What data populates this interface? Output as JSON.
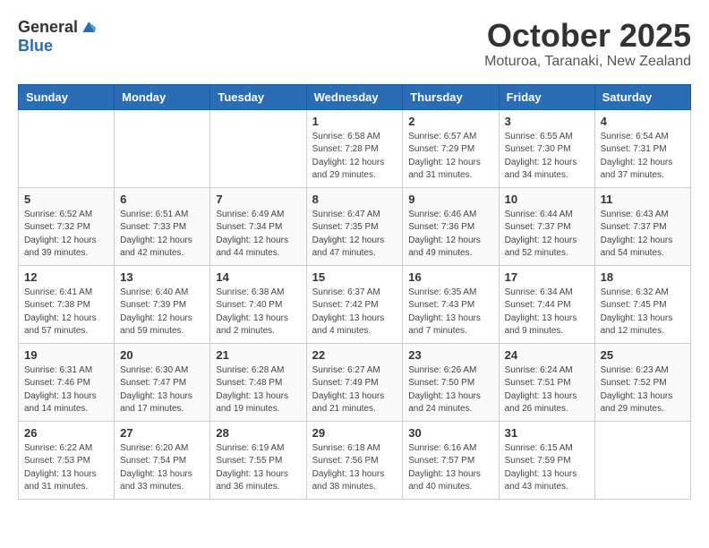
{
  "header": {
    "logo_general": "General",
    "logo_blue": "Blue",
    "month_title": "October 2025",
    "location": "Moturoa, Taranaki, New Zealand"
  },
  "days_of_week": [
    "Sunday",
    "Monday",
    "Tuesday",
    "Wednesday",
    "Thursday",
    "Friday",
    "Saturday"
  ],
  "weeks": [
    [
      {
        "day": "",
        "info": ""
      },
      {
        "day": "",
        "info": ""
      },
      {
        "day": "",
        "info": ""
      },
      {
        "day": "1",
        "info": "Sunrise: 6:58 AM\nSunset: 7:28 PM\nDaylight: 12 hours and 29 minutes."
      },
      {
        "day": "2",
        "info": "Sunrise: 6:57 AM\nSunset: 7:29 PM\nDaylight: 12 hours and 31 minutes."
      },
      {
        "day": "3",
        "info": "Sunrise: 6:55 AM\nSunset: 7:30 PM\nDaylight: 12 hours and 34 minutes."
      },
      {
        "day": "4",
        "info": "Sunrise: 6:54 AM\nSunset: 7:31 PM\nDaylight: 12 hours and 37 minutes."
      }
    ],
    [
      {
        "day": "5",
        "info": "Sunrise: 6:52 AM\nSunset: 7:32 PM\nDaylight: 12 hours and 39 minutes."
      },
      {
        "day": "6",
        "info": "Sunrise: 6:51 AM\nSunset: 7:33 PM\nDaylight: 12 hours and 42 minutes."
      },
      {
        "day": "7",
        "info": "Sunrise: 6:49 AM\nSunset: 7:34 PM\nDaylight: 12 hours and 44 minutes."
      },
      {
        "day": "8",
        "info": "Sunrise: 6:47 AM\nSunset: 7:35 PM\nDaylight: 12 hours and 47 minutes."
      },
      {
        "day": "9",
        "info": "Sunrise: 6:46 AM\nSunset: 7:36 PM\nDaylight: 12 hours and 49 minutes."
      },
      {
        "day": "10",
        "info": "Sunrise: 6:44 AM\nSunset: 7:37 PM\nDaylight: 12 hours and 52 minutes."
      },
      {
        "day": "11",
        "info": "Sunrise: 6:43 AM\nSunset: 7:37 PM\nDaylight: 12 hours and 54 minutes."
      }
    ],
    [
      {
        "day": "12",
        "info": "Sunrise: 6:41 AM\nSunset: 7:38 PM\nDaylight: 12 hours and 57 minutes."
      },
      {
        "day": "13",
        "info": "Sunrise: 6:40 AM\nSunset: 7:39 PM\nDaylight: 12 hours and 59 minutes."
      },
      {
        "day": "14",
        "info": "Sunrise: 6:38 AM\nSunset: 7:40 PM\nDaylight: 13 hours and 2 minutes."
      },
      {
        "day": "15",
        "info": "Sunrise: 6:37 AM\nSunset: 7:42 PM\nDaylight: 13 hours and 4 minutes."
      },
      {
        "day": "16",
        "info": "Sunrise: 6:35 AM\nSunset: 7:43 PM\nDaylight: 13 hours and 7 minutes."
      },
      {
        "day": "17",
        "info": "Sunrise: 6:34 AM\nSunset: 7:44 PM\nDaylight: 13 hours and 9 minutes."
      },
      {
        "day": "18",
        "info": "Sunrise: 6:32 AM\nSunset: 7:45 PM\nDaylight: 13 hours and 12 minutes."
      }
    ],
    [
      {
        "day": "19",
        "info": "Sunrise: 6:31 AM\nSunset: 7:46 PM\nDaylight: 13 hours and 14 minutes."
      },
      {
        "day": "20",
        "info": "Sunrise: 6:30 AM\nSunset: 7:47 PM\nDaylight: 13 hours and 17 minutes."
      },
      {
        "day": "21",
        "info": "Sunrise: 6:28 AM\nSunset: 7:48 PM\nDaylight: 13 hours and 19 minutes."
      },
      {
        "day": "22",
        "info": "Sunrise: 6:27 AM\nSunset: 7:49 PM\nDaylight: 13 hours and 21 minutes."
      },
      {
        "day": "23",
        "info": "Sunrise: 6:26 AM\nSunset: 7:50 PM\nDaylight: 13 hours and 24 minutes."
      },
      {
        "day": "24",
        "info": "Sunrise: 6:24 AM\nSunset: 7:51 PM\nDaylight: 13 hours and 26 minutes."
      },
      {
        "day": "25",
        "info": "Sunrise: 6:23 AM\nSunset: 7:52 PM\nDaylight: 13 hours and 29 minutes."
      }
    ],
    [
      {
        "day": "26",
        "info": "Sunrise: 6:22 AM\nSunset: 7:53 PM\nDaylight: 13 hours and 31 minutes."
      },
      {
        "day": "27",
        "info": "Sunrise: 6:20 AM\nSunset: 7:54 PM\nDaylight: 13 hours and 33 minutes."
      },
      {
        "day": "28",
        "info": "Sunrise: 6:19 AM\nSunset: 7:55 PM\nDaylight: 13 hours and 36 minutes."
      },
      {
        "day": "29",
        "info": "Sunrise: 6:18 AM\nSunset: 7:56 PM\nDaylight: 13 hours and 38 minutes."
      },
      {
        "day": "30",
        "info": "Sunrise: 6:16 AM\nSunset: 7:57 PM\nDaylight: 13 hours and 40 minutes."
      },
      {
        "day": "31",
        "info": "Sunrise: 6:15 AM\nSunset: 7:59 PM\nDaylight: 13 hours and 43 minutes."
      },
      {
        "day": "",
        "info": ""
      }
    ]
  ]
}
